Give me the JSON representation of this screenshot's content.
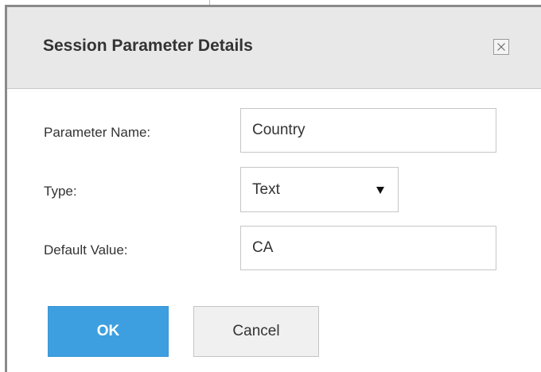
{
  "dialog": {
    "title": "Session Parameter Details",
    "close_icon": "close-icon"
  },
  "form": {
    "parameter_name": {
      "label": "Parameter Name:",
      "value": "Country"
    },
    "type": {
      "label": "Type:",
      "selected": "Text",
      "arrow_icon": "dropdown-arrow-icon"
    },
    "default_value": {
      "label": "Default Value:",
      "value": "CA"
    }
  },
  "buttons": {
    "ok_label": "OK",
    "cancel_label": "Cancel"
  },
  "colors": {
    "primary_button": "#3d9fdf",
    "header_background": "#e8e8e8",
    "text": "#333333"
  }
}
